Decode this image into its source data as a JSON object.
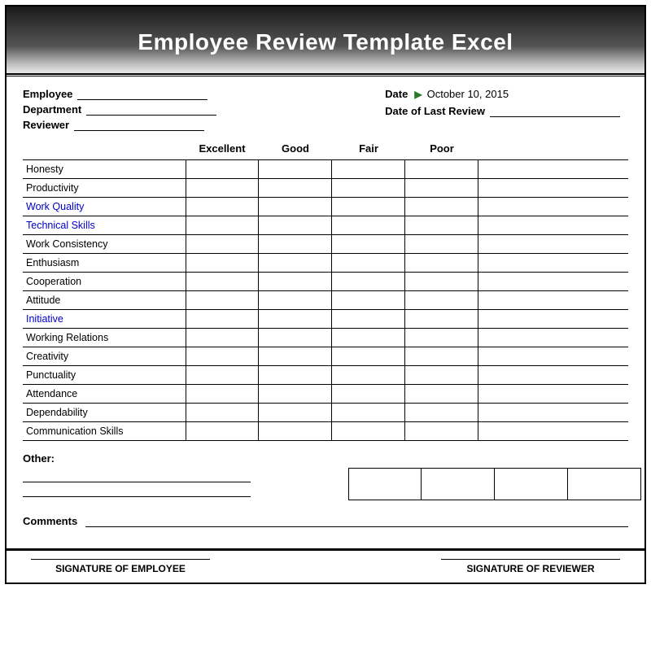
{
  "header": {
    "title": "Employee Review Template Excel"
  },
  "info": {
    "employee_label": "Employee",
    "department_label": "Department",
    "reviewer_label": "Reviewer",
    "date_label": "Date",
    "date_value": "October 10, 2015",
    "last_review_label": "Date of Last Review"
  },
  "rating_headers": [
    "Excellent",
    "Good",
    "Fair",
    "Poor"
  ],
  "items": [
    {
      "label": "Honesty",
      "blue": false
    },
    {
      "label": "Productivity",
      "blue": false
    },
    {
      "label": "Work Quality",
      "blue": true
    },
    {
      "label": "Technical Skills",
      "blue": true
    },
    {
      "label": "Work Consistency",
      "blue": false
    },
    {
      "label": "Enthusiasm",
      "blue": false
    },
    {
      "label": "Cooperation",
      "blue": false
    },
    {
      "label": "Attitude",
      "blue": false
    },
    {
      "label": "Initiative",
      "blue": true
    },
    {
      "label": "Working Relations",
      "blue": false
    },
    {
      "label": "Creativity",
      "blue": false
    },
    {
      "label": "Punctuality",
      "blue": false
    },
    {
      "label": "Attendance",
      "blue": false
    },
    {
      "label": "Dependability",
      "blue": false
    },
    {
      "label": "Communication Skills",
      "blue": false
    }
  ],
  "other_label": "Other:",
  "comments_label": "Comments",
  "signatures": {
    "employee_label": "SIGNATURE OF EMPLOYEE",
    "reviewer_label": "SIGNATURE OF REVIEWER"
  }
}
